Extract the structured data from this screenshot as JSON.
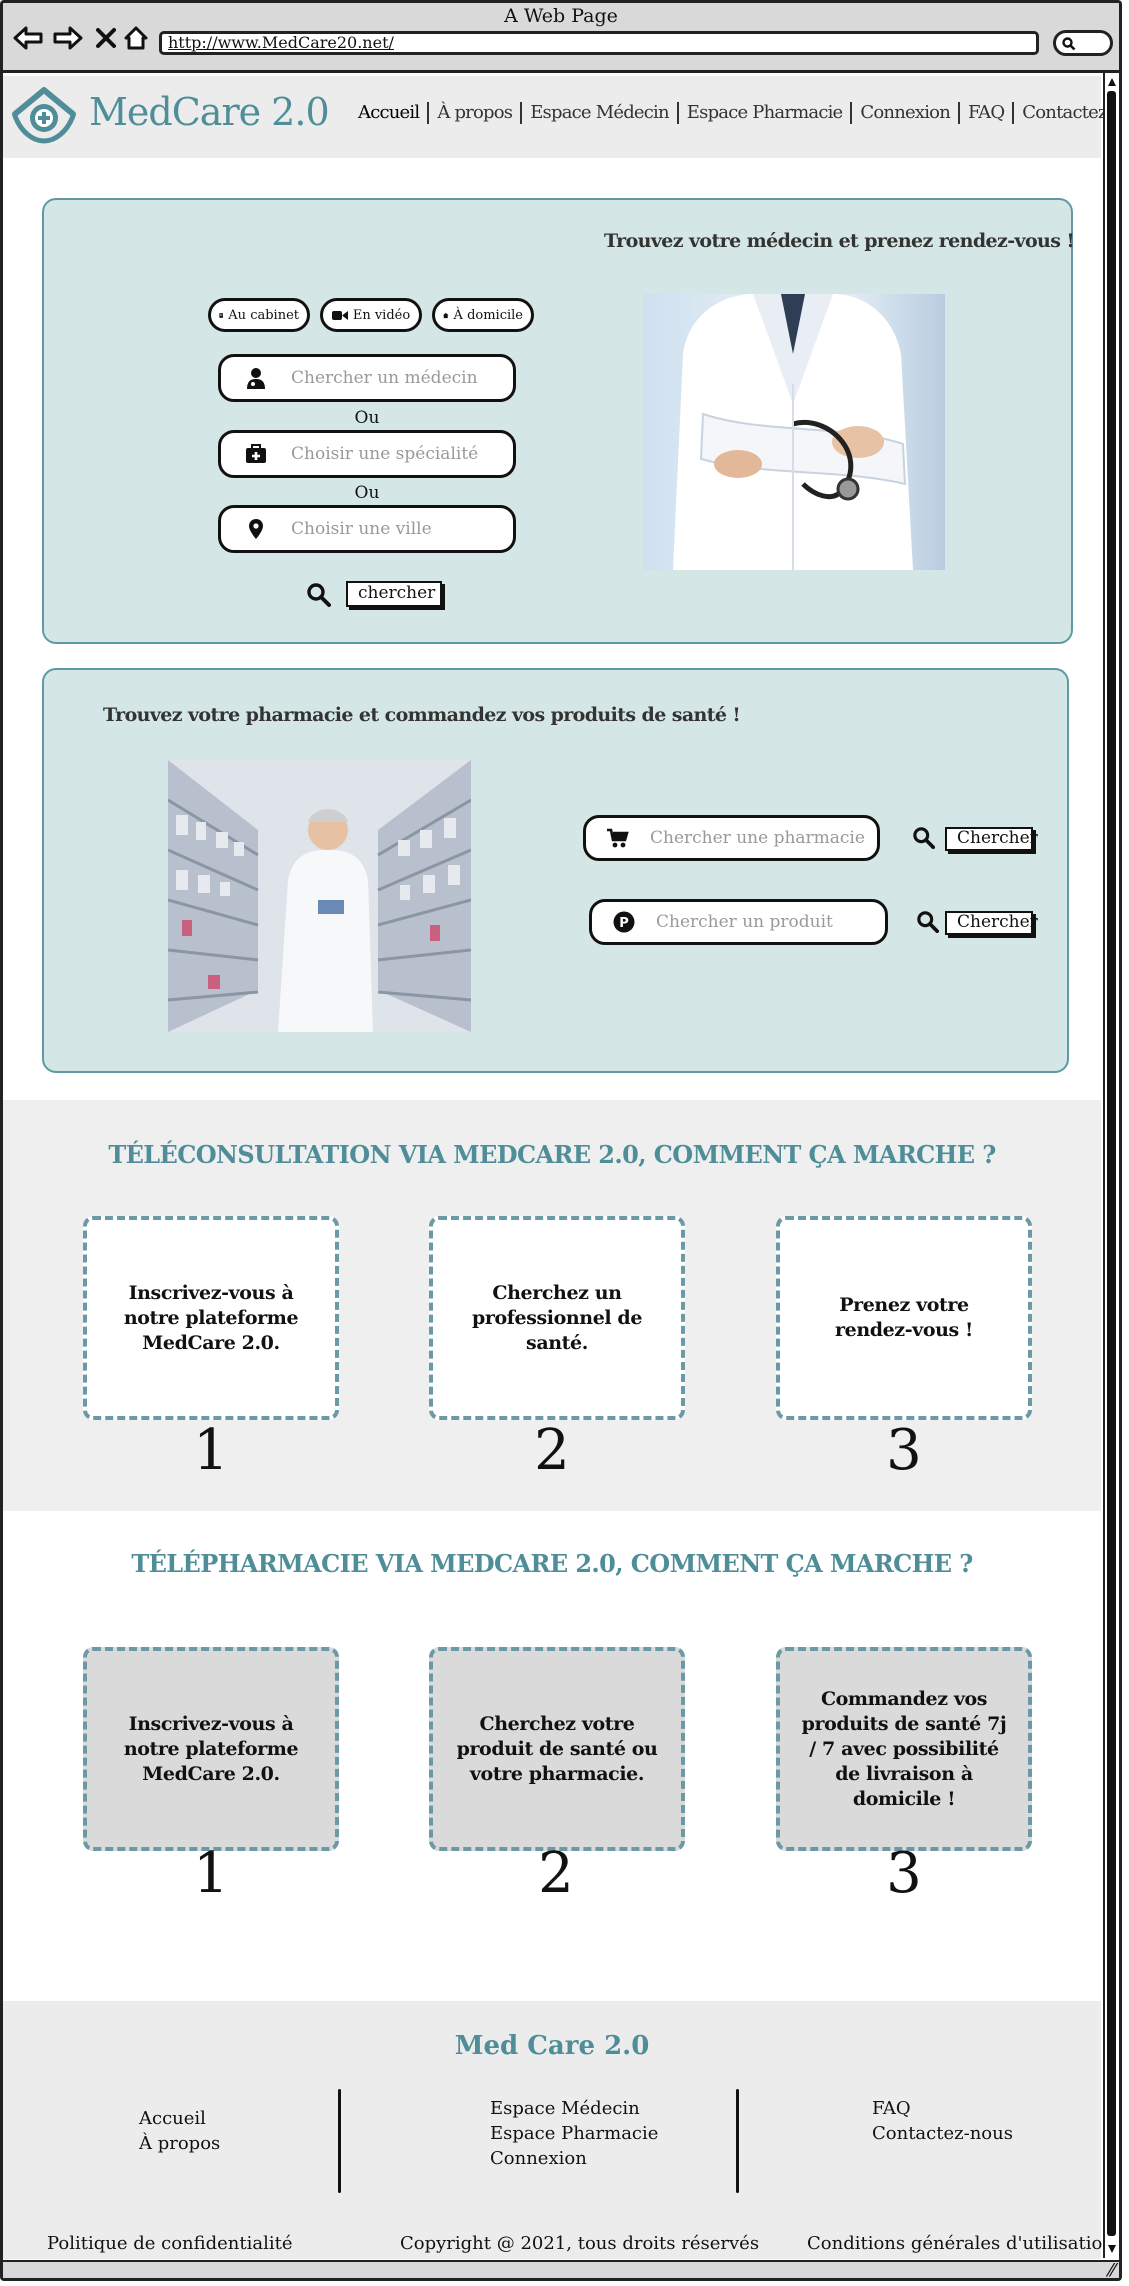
{
  "browser": {
    "window_title": "A Web Page",
    "url": "http://www.MedCare20.net/"
  },
  "header": {
    "logo_text": "MedCare 2.0",
    "nav": [
      "Accueil",
      "À propos",
      "Espace Médecin",
      "Espace Pharmacie",
      "Connexion",
      "FAQ",
      "Contactez-nous"
    ]
  },
  "doctor_search": {
    "title": "Trouvez votre médecin et prenez rendez-vous !",
    "modes": [
      "Au cabinet",
      "En vidéo",
      "À domicile"
    ],
    "doctor_placeholder": "Chercher un médecin",
    "or_1": "Ou",
    "specialty_placeholder": "Choisir une spécialité",
    "or_2": "Ou",
    "city_placeholder": "Choisir une ville",
    "search_button": "chercher"
  },
  "pharmacy_search": {
    "title": "Trouvez votre pharmacie et commandez vos produits de santé !",
    "pharmacy_placeholder": "Chercher une pharmacie",
    "pharmacy_button": "Chercher",
    "product_placeholder": "Chercher un produit",
    "product_button": "Chercher"
  },
  "teleconsultation": {
    "title": "TÉLÉCONSULTATION VIA MEDCARE 2.0, COMMENT ÇA MARCHE ?",
    "steps": [
      {
        "text": "Inscrivez-vous à notre plateforme MedCare 2.0.",
        "num": "1"
      },
      {
        "text": "Cherchez un professionnel de santé.",
        "num": "2"
      },
      {
        "text": "Prenez votre rendez-vous !",
        "num": "3"
      }
    ]
  },
  "telepharmacie": {
    "title": "TÉLÉPHARMACIE VIA MEDCARE 2.0, COMMENT ÇA MARCHE ?",
    "steps": [
      {
        "text": "Inscrivez-vous à notre plateforme MedCare 2.0.",
        "num": "1"
      },
      {
        "text": "Cherchez votre produit de santé ou votre pharmacie.",
        "num": "2"
      },
      {
        "text": "Commandez vos produits de santé 7j / 7 avec possibilité de livraison à domicile !",
        "num": "3"
      }
    ]
  },
  "footer": {
    "title": "Med Care 2.0",
    "col1": [
      "Accueil",
      "À propos"
    ],
    "col2": [
      "Espace Médecin",
      "Espace Pharmacie",
      "Connexion"
    ],
    "col3": [
      "FAQ",
      "Contactez-nous"
    ],
    "privacy": "Politique de confidentialité",
    "copyright": "Copyright @ 2021, tous droits réservés",
    "terms": "Conditions générales d'utilisation"
  },
  "colors": {
    "accent": "#4f8e99",
    "panel_bg": "#d4e7e6",
    "panel_border": "#5f9aa3",
    "band_bg": "#efefef"
  }
}
